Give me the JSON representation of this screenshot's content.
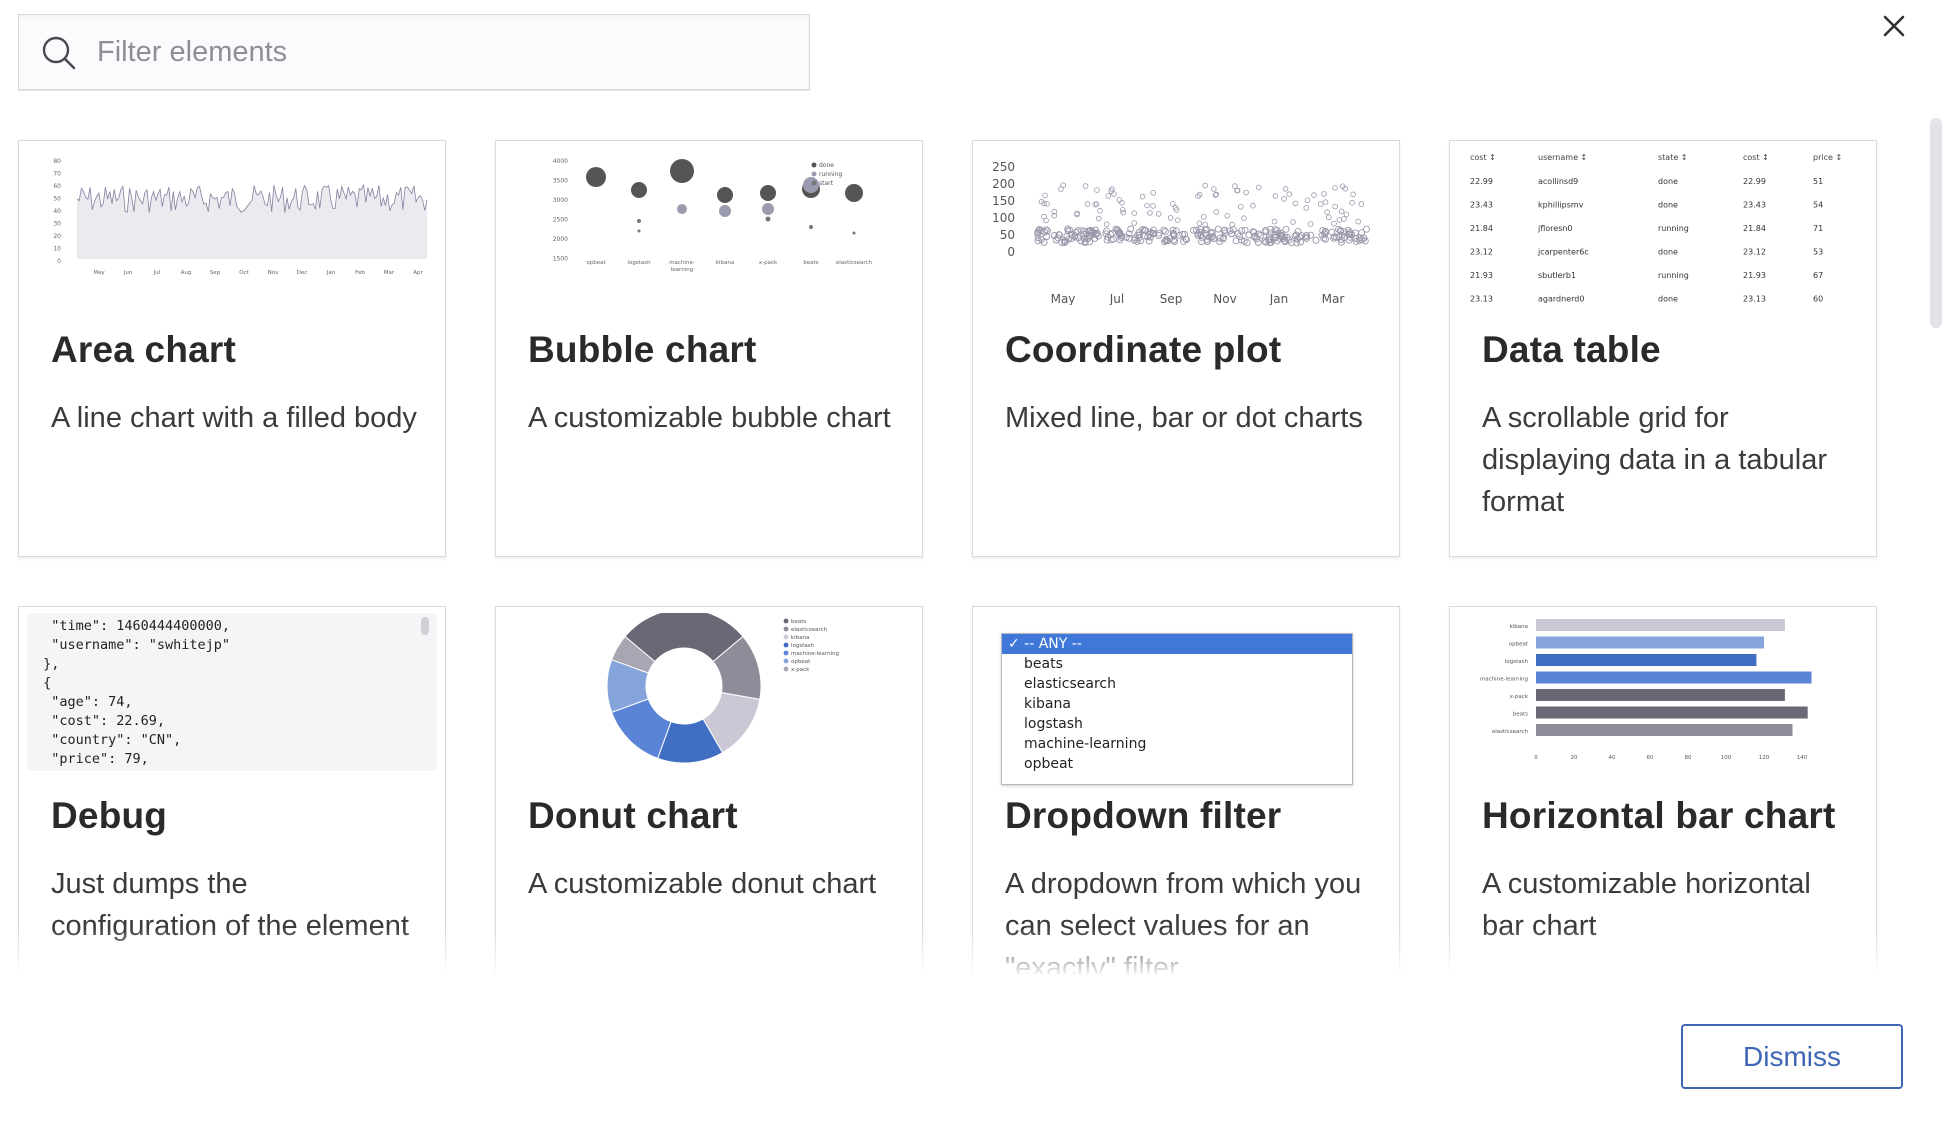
{
  "search": {
    "placeholder": "Filter elements"
  },
  "cards": [
    {
      "title": "Area chart",
      "description": "A line chart with a filled body"
    },
    {
      "title": "Bubble chart",
      "description": "A customizable bubble chart"
    },
    {
      "title": "Coordinate plot",
      "description": "Mixed line, bar or dot charts"
    },
    {
      "title": "Data table",
      "description": "A scrollable grid for displaying data in a tabular format"
    },
    {
      "title": "Debug",
      "description": "Just dumps the configuration of the element"
    },
    {
      "title": "Donut chart",
      "description": "A customizable donut chart"
    },
    {
      "title": "Dropdown filter",
      "description": "A dropdown from which you can select values for an \"exactly\" filter"
    },
    {
      "title": "Horizontal bar chart",
      "description": "A customizable horizontal bar chart"
    }
  ],
  "previews": {
    "area": {
      "y_ticks": [
        "80",
        "70",
        "60",
        "50",
        "40",
        "30",
        "20",
        "10",
        "0"
      ],
      "x_ticks": [
        "May",
        "Jun",
        "Jul",
        "Aug",
        "Sep",
        "Oct",
        "Nov",
        "Dec",
        "Jan",
        "Feb",
        "Mar",
        "Apr"
      ]
    },
    "bubble": {
      "y_ticks": [
        "4000",
        "3500",
        "3000",
        "2500",
        "2000",
        "1500"
      ],
      "x_ticks": [
        "opbeat",
        "logstash",
        "machine-learning",
        "kibana",
        "x-pack",
        "beats",
        "elasticsearch"
      ],
      "legend": [
        "done",
        "running",
        "start"
      ]
    },
    "coordinate": {
      "y_ticks": [
        "250",
        "200",
        "150",
        "100",
        "50",
        "0"
      ],
      "x_ticks": [
        "May",
        "Jul",
        "Sep",
        "Nov",
        "Jan",
        "Mar"
      ]
    },
    "table": {
      "headers": [
        "cost ↕",
        "username ↕",
        "state ↕",
        "cost ↕",
        "price ↕"
      ],
      "rows": [
        [
          "22.99",
          "acollinsd9",
          "done",
          "22.99",
          "51"
        ],
        [
          "23.43",
          "kphillipsmv",
          "done",
          "23.43",
          "54"
        ],
        [
          "21.84",
          "jfloresn0",
          "running",
          "21.84",
          "71"
        ],
        [
          "23.12",
          "jcarpenter6c",
          "done",
          "23.12",
          "53"
        ],
        [
          "21.93",
          "sbutlerb1",
          "running",
          "21.93",
          "67"
        ],
        [
          "23.13",
          "agardnerd0",
          "done",
          "23.13",
          "60"
        ]
      ]
    },
    "debug": {
      "lines": [
        "  \"time\": 1460444400000,",
        "  \"username\": \"swhitejp\"",
        " },",
        " {",
        "  \"age\": 74,",
        "  \"cost\": 22.69,",
        "  \"country\": \"CN\",",
        "  \"price\": 79,"
      ]
    },
    "donut": {
      "legend": [
        "beats",
        "elasticsearch",
        "kibana",
        "logstash",
        "machine-learning",
        "opbeat",
        "x-pack"
      ]
    },
    "dropdown": {
      "selected": "✓ -- ANY --",
      "options": [
        "beats",
        "elasticsearch",
        "kibana",
        "logstash",
        "machine-learning",
        "opbeat"
      ]
    },
    "hbar": {
      "categories": [
        "kibana",
        "opbeat",
        "logstash",
        "machine-learning",
        "x-pack",
        "beats",
        "elasticsearch"
      ],
      "x_ticks": [
        "0",
        "20",
        "40",
        "60",
        "80",
        "100",
        "120",
        "140"
      ]
    }
  },
  "footer": {
    "dismiss_label": "Dismiss"
  }
}
